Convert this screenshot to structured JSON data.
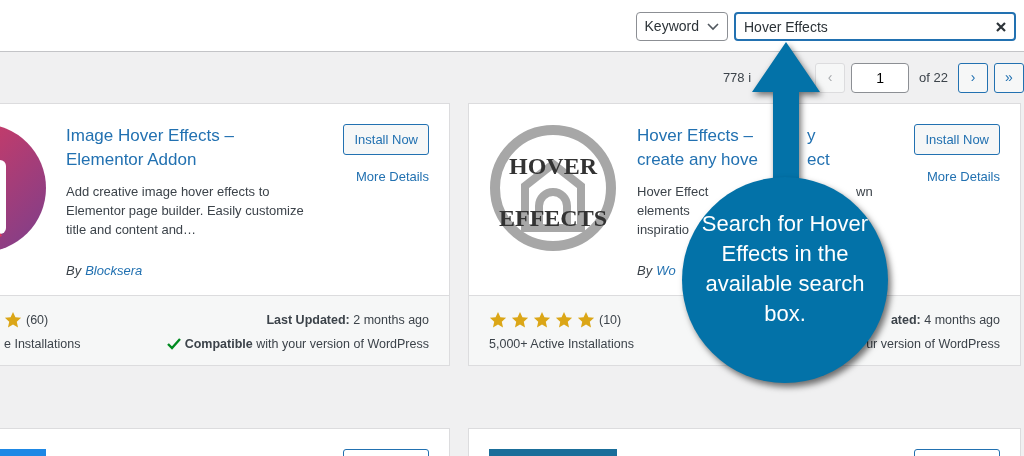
{
  "search": {
    "filter": "Keyword",
    "query": "Hover Effects"
  },
  "pagination": {
    "count": "778 i",
    "prev": "‹",
    "page": "1",
    "of": "of 22",
    "next": "›",
    "last": "»"
  },
  "plugins": [
    {
      "kind": "image",
      "title_lines": [
        [
          "Image Hover Effects –"
        ],
        [
          "Elementor Addon"
        ]
      ],
      "install": "Install Now",
      "details": "More Details",
      "desc_lines": [
        [
          "Add creative image hover effects to"
        ],
        [
          "Elementor page builder. Easily customize"
        ],
        [
          "title and content and…"
        ]
      ],
      "by": "By",
      "author": "Blocksera",
      "rating": "(60)",
      "installs": "e Installations",
      "updated_label": "Last Updated:",
      "updated": "2 months ago",
      "compatible": true,
      "compat_label": "Compatible",
      "compat_rest": "with your version of WordPress"
    },
    {
      "kind": "logo",
      "logo_top": "HOVER",
      "logo_bottom": "EFFECTS",
      "title_lines": [
        [
          "Hover Effects –",
          "y"
        ],
        [
          "create any hove",
          "ect"
        ]
      ],
      "install": "Install Now",
      "details": "More Details",
      "desc_lines": [
        [
          "Hover Effect",
          "wn"
        ],
        [
          "elements"
        ],
        [
          "inspiratio"
        ]
      ],
      "by": "By",
      "author": "Wo",
      "stars": 5,
      "rating": "(10)",
      "installs": "5,000+ Active Installations",
      "updated_label": "ated:",
      "updated": "4 months ago",
      "compat_rest": "ur version of WordPress"
    }
  ],
  "more_cards": [
    {
      "color": "#1e88e5"
    },
    {
      "color": "#1a6e9a"
    }
  ],
  "callout": {
    "text": "Search for Hover Effects in the available search box."
  }
}
